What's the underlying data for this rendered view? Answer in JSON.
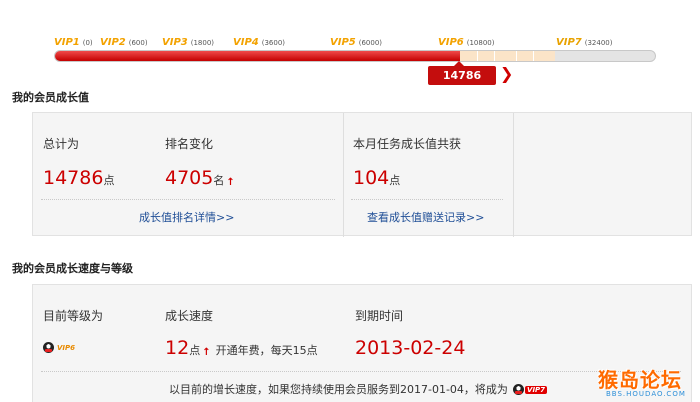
{
  "progress": {
    "levels": [
      {
        "name": "VIP1",
        "value": "(0)"
      },
      {
        "name": "VIP2",
        "value": "(600)"
      },
      {
        "name": "VIP3",
        "value": "(1800)"
      },
      {
        "name": "VIP4",
        "value": "(3600)"
      },
      {
        "name": "VIP5",
        "value": "(6000)"
      },
      {
        "name": "VIP6",
        "value": "(10800)"
      },
      {
        "name": "VIP7",
        "value": "(32400)"
      }
    ],
    "current_value": "14786",
    "fill_fraction": 0.673,
    "colors": {
      "fill": "#cc0000",
      "pending": "#fbe4c8",
      "empty": "#e4e4e4",
      "level_label": "#f3a200"
    }
  },
  "growth_value": {
    "section_title": "我的会员成长值",
    "total_label": "总计为",
    "total_value": "14786",
    "total_unit": "点",
    "rank_label": "排名变化",
    "rank_value": "4705",
    "rank_unit": "名",
    "rank_trend_icon": "up-arrow-icon",
    "monthly_label": "本月任务成长值共获",
    "monthly_value": "104",
    "monthly_unit": "点",
    "rank_detail_link": "成长值排名详情>>",
    "gift_record_link": "查看成长值赠送记录>>"
  },
  "growth_speed": {
    "section_title": "我的会员成长速度与等级",
    "level_label": "目前等级为",
    "level_badge": "VIP6",
    "speed_label": "成长速度",
    "speed_value": "12",
    "speed_unit": "点",
    "speed_note": "开通年费，每天15点",
    "expiry_label": "到期时间",
    "expiry_value": "2013-02-24",
    "forecast_text": "以目前的增长速度，如果您持续使用会员服务到2017-01-04，将成为",
    "forecast_badge": "VIP7"
  },
  "watermark": {
    "main": "猴岛论坛",
    "sub": "BBS.HOUDAO.COM"
  }
}
